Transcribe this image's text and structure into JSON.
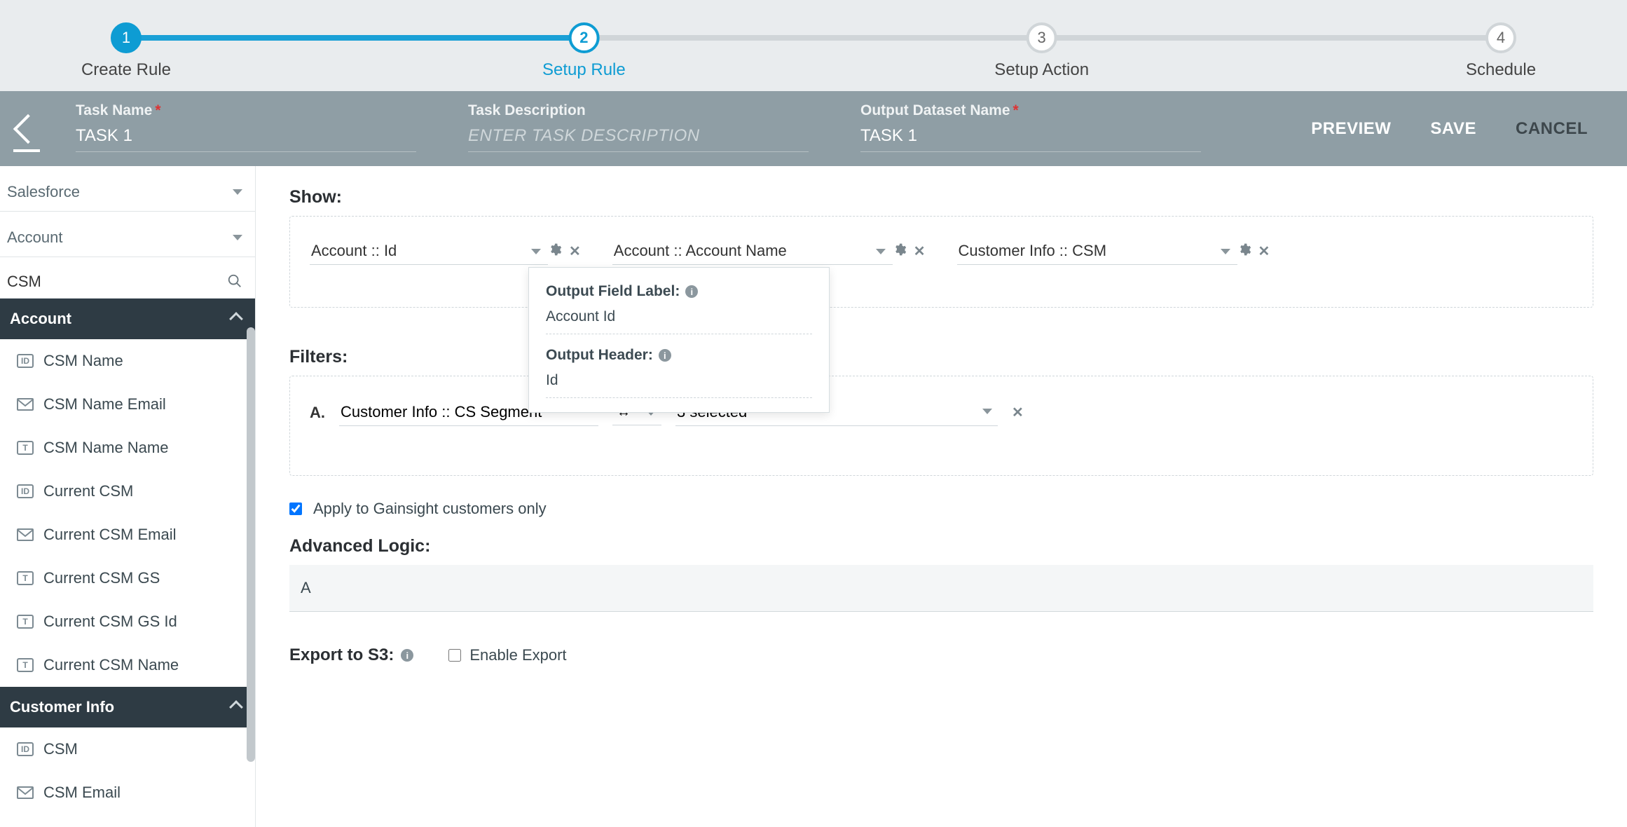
{
  "stepper": {
    "steps": [
      {
        "num": "1",
        "label": "Create Rule",
        "state": "done"
      },
      {
        "num": "2",
        "label": "Setup Rule",
        "state": "current"
      },
      {
        "num": "3",
        "label": "Setup Action",
        "state": "pending"
      },
      {
        "num": "4",
        "label": "Schedule",
        "state": "pending"
      }
    ]
  },
  "task_header": {
    "task_name_label": "Task Name",
    "task_name_value": "TASK 1",
    "task_desc_label": "Task Description",
    "task_desc_placeholder": "ENTER TASK DESCRIPTION",
    "output_name_label": "Output Dataset Name",
    "output_name_value": "TASK 1",
    "preview": "PREVIEW",
    "save": "SAVE",
    "cancel": "CANCEL"
  },
  "sidebar": {
    "source_dd": "Salesforce",
    "object_dd": "Account",
    "search_value": "CSM",
    "groups": [
      {
        "title": "Account",
        "items": [
          {
            "type": "ID",
            "label": "CSM Name"
          },
          {
            "type": "mail",
            "label": "CSM Name Email"
          },
          {
            "type": "T",
            "label": "CSM Name Name"
          },
          {
            "type": "ID",
            "label": "Current CSM"
          },
          {
            "type": "mail",
            "label": "Current CSM Email"
          },
          {
            "type": "T",
            "label": "Current CSM GS"
          },
          {
            "type": "T",
            "label": "Current CSM GS Id"
          },
          {
            "type": "T",
            "label": "Current CSM Name"
          }
        ]
      },
      {
        "title": "Customer Info",
        "items": [
          {
            "type": "ID",
            "label": "CSM"
          },
          {
            "type": "mail",
            "label": "CSM Email"
          }
        ]
      }
    ]
  },
  "content": {
    "show_title": "Show:",
    "show_fields": [
      "Account :: Id",
      "Account :: Account Name",
      "Customer Info :: CSM"
    ],
    "popover": {
      "label1": "Output Field Label:",
      "val1": "Account Id",
      "label2": "Output Header:",
      "val2": "Id"
    },
    "filters_title": "Filters:",
    "filters": [
      {
        "letter": "A.",
        "field": "Customer Info :: CS Segment",
        "op": "↔",
        "value": "3 selected"
      }
    ],
    "apply_gainsight": "Apply to Gainsight customers only",
    "advanced_title": "Advanced Logic:",
    "advanced_value": "A",
    "export_title": "Export to S3:",
    "export_cb_label": "Enable Export"
  }
}
